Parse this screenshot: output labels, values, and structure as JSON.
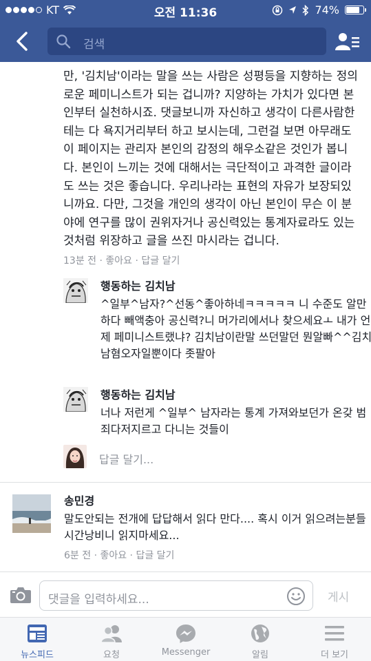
{
  "status_bar": {
    "carrier": "KT",
    "time": "오전 11:36",
    "battery": "74%"
  },
  "nav": {
    "search_placeholder": "검색"
  },
  "post": {
    "text": "만, '김치남'이라는 말을 쓰는 사람은 성평등을 지향하는 정의로운 페미니스트가 되는 겁니까? 지양하는 가치가 있다면 본인부터 실천하시죠. 댓글보니까 자신하고 생각이 다른사람한테는 다 욕지거리부터 하고 보시는데, 그런걸 보면 아무래도 이 페이지는 관리자 본인의 감정의 해우소같은 것인가 봅니다. 본인이 느끼는 것에 대해서는 극단적이고 과격한 글이라도 쓰는 것은 좋습니다. 우리나라는 표현의 자유가 보장되있니까요. 다만, 그것을 개인의 생각이 아닌 본인이 무슨 이 분야에 연구를 많이 권위자거나 공신력있는 통계자료라도 있는 것처럼 위장하고 글을 쓰진 마시라는 겁니다.",
    "meta": "13분 전 · 좋아요 · 답글 달기"
  },
  "replies": [
    {
      "author": "행동하는 김치남",
      "text": "^일부^남자?^선동^좋아하네ㅋㅋㅋㅋㅋ 니 수준도 알만하다 빼액충아  공신력?니 머가리에서나 찾으세요ㅗ 내가 언제 페미니스트랬냐?  김치남이란말 쓰던말던 뭔알빠^^김치남혐오자일뿐이다 좃팔아"
    },
    {
      "author": "행동하는 김치남",
      "text": "너나 저런게 ^일부^ 남자라는 통계 가져와보던가 온갖 범죄다저지르고 다니는 것들이"
    }
  ],
  "reply_prompt": "답글 달기...",
  "comment": {
    "author": "송민경",
    "text": "말도안되는 전개에 답답해서 읽다 만다.... 혹시 이거 읽으려는분들 시간낭비니 읽지마세요...",
    "meta": "6분 전 · 좋아요 · 답글 달기"
  },
  "composer": {
    "placeholder": "댓글을 입력하세요...",
    "post_label": "게시"
  },
  "tabs": [
    {
      "label": "뉴스피드",
      "icon": "news-feed-icon",
      "active": true
    },
    {
      "label": "요청",
      "icon": "friend-requests-icon",
      "active": false
    },
    {
      "label": "Messenger",
      "icon": "messenger-icon",
      "active": false
    },
    {
      "label": "알림",
      "icon": "notifications-globe-icon",
      "active": false
    },
    {
      "label": "더 보기",
      "icon": "more-menu-icon",
      "active": false
    }
  ],
  "colors": {
    "brand": "#3b5998",
    "search_bg": "#2c4682",
    "text": "#1d2129",
    "meta": "#90949c",
    "active_tab": "#4267b2"
  }
}
